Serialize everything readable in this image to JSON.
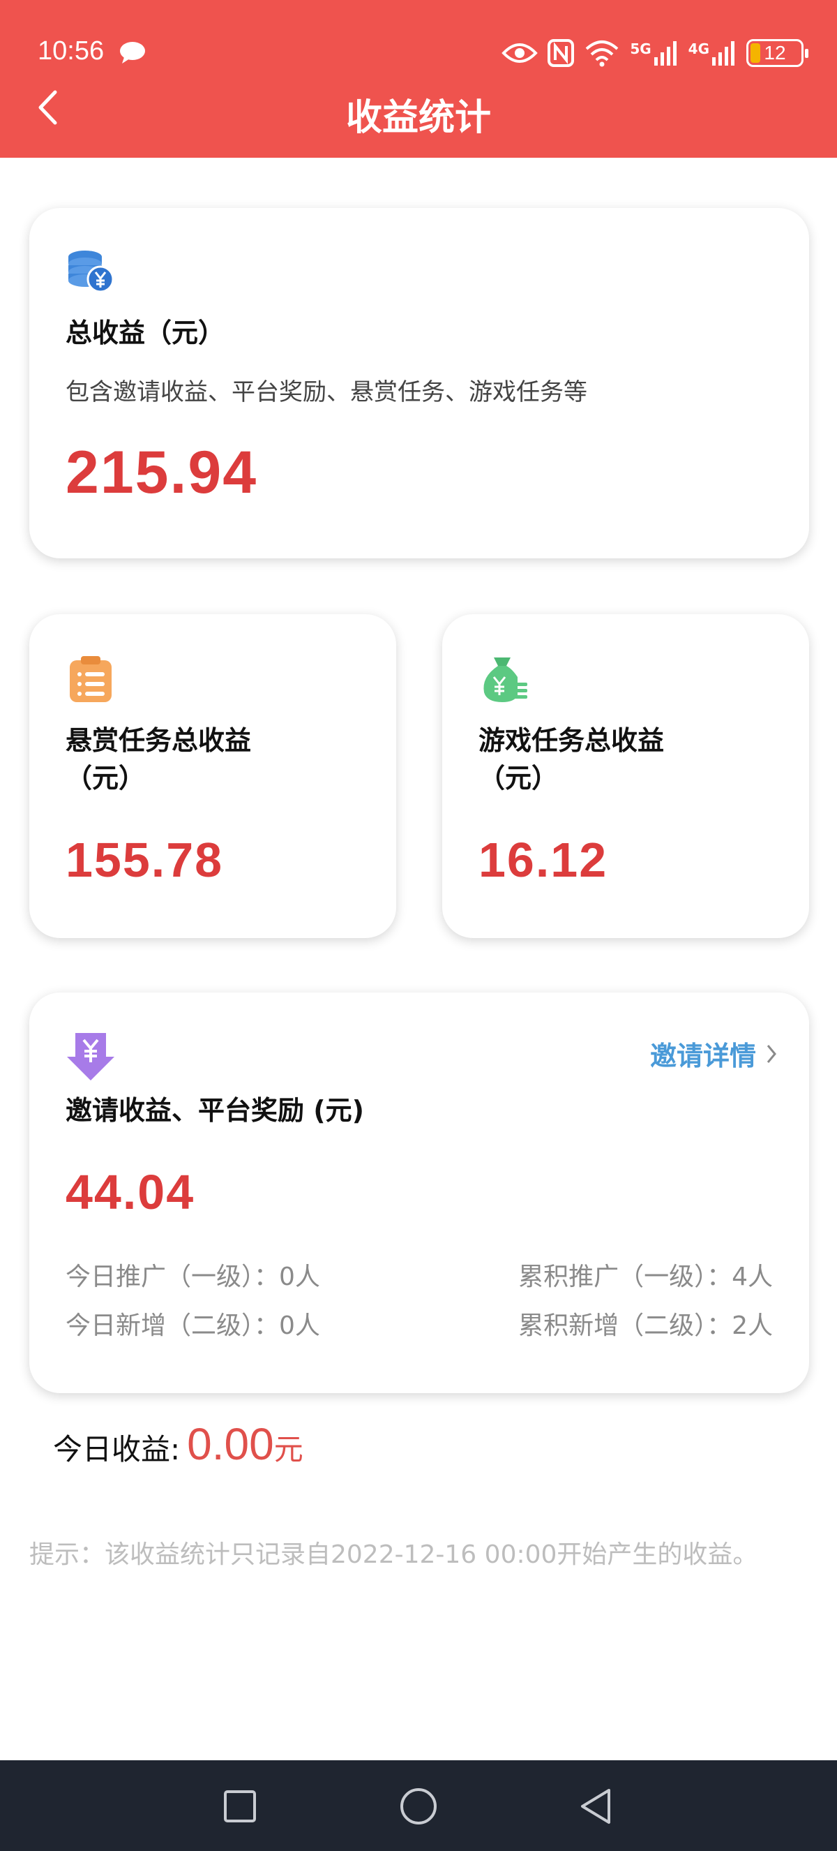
{
  "status_bar": {
    "time": "10:56",
    "network_5g": "5G",
    "network_4g": "4G",
    "battery": "12"
  },
  "header": {
    "title": "收益统计"
  },
  "total_card": {
    "icon": "coins-yuan-icon",
    "title": "总收益（元）",
    "subtitle": "包含邀请收益、平台奖励、悬赏任务、游戏任务等",
    "amount": "215.94"
  },
  "bounty_card": {
    "icon": "clipboard-list-icon",
    "title_line1": "悬赏任务总收益",
    "title_line2": "（元）",
    "amount": "155.78"
  },
  "game_card": {
    "icon": "money-bag-icon",
    "title_line1": "游戏任务总收益",
    "title_line2": "（元）",
    "amount": "16.12"
  },
  "invite_card": {
    "icon": "yuan-down-arrow-icon",
    "title": "邀请收益、平台奖励 (元)",
    "link_label": "邀请详情",
    "amount": "44.04",
    "stats": {
      "today_promote": "今日推广（一级）：0人",
      "today_new": "今日新增（二级）：0人",
      "total_promote": "累积推广（一级）：4人",
      "total_new": "累积新增（二级）：2人"
    }
  },
  "today": {
    "label": "今日收益:",
    "value": "0.00",
    "unit": "元"
  },
  "tip": "提示：该收益统计只记录自2022-12-16 00:00开始产生的收益。",
  "colors": {
    "header_bg": "#EF534E",
    "amount": "#DC3C3C",
    "link": "#4A9AD8",
    "nav_bg": "#1F2530"
  }
}
